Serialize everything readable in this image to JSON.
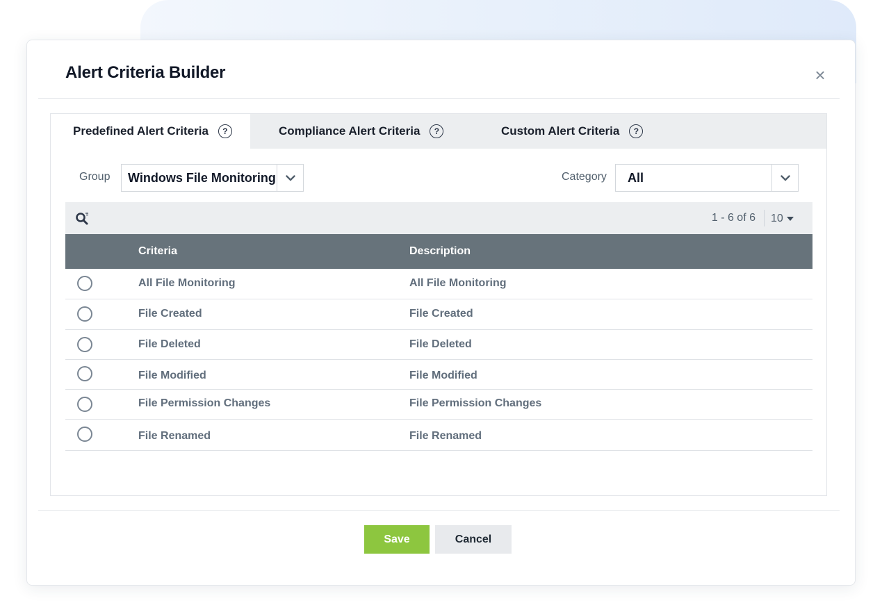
{
  "dialog": {
    "title": "Alert Criteria Builder",
    "close_icon": "close-icon"
  },
  "tabs": [
    {
      "label": "Predefined Alert Criteria",
      "help_icon": "?",
      "active": true
    },
    {
      "label": "Compliance Alert Criteria",
      "help_icon": "?",
      "active": false
    },
    {
      "label": "Custom Alert Criteria",
      "help_icon": "?",
      "active": false
    }
  ],
  "filters": {
    "group_label": "Group",
    "group_value": "Windows File Monitoring",
    "category_label": "Category",
    "category_value": "All"
  },
  "toolbar": {
    "search_icon": "search-icon",
    "pager_info": "1 - 6 of 6",
    "page_size": "10"
  },
  "table": {
    "columns": [
      "Criteria",
      "Description"
    ],
    "rows": [
      {
        "criteria": "All File Monitoring",
        "description": "All File Monitoring",
        "selected": false
      },
      {
        "criteria": "File Created",
        "description": "File Created",
        "selected": false
      },
      {
        "criteria": "File Deleted",
        "description": "File Deleted",
        "selected": false
      },
      {
        "criteria": "File Modified",
        "description": "File Modified",
        "selected": false
      },
      {
        "criteria": "File Permission Changes",
        "description": "File Permission Changes",
        "selected": false
      },
      {
        "criteria": "File Renamed",
        "description": "File Renamed",
        "selected": false
      }
    ]
  },
  "footer": {
    "save_label": "Save",
    "cancel_label": "Cancel"
  },
  "colors": {
    "accent_save": "#8dc63f",
    "table_header": "#67737b",
    "tabbar": "#eceef0"
  }
}
